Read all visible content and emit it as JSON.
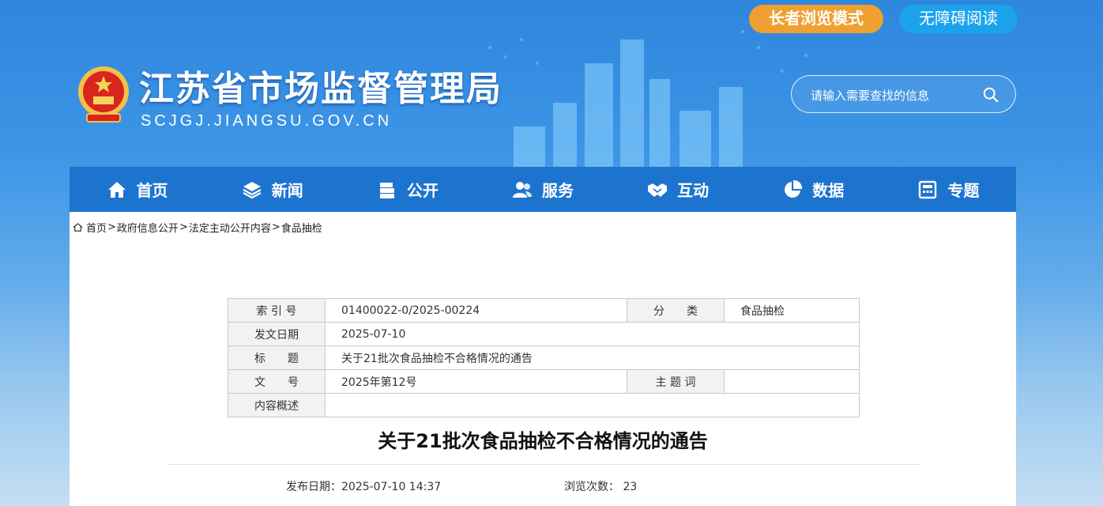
{
  "top_buttons": {
    "elder_mode": "长者浏览模式",
    "accessible": "无障碍阅读"
  },
  "header": {
    "title": "江苏省市场监督管理局",
    "url": "SCJGJ.JIANGSU.GOV.CN",
    "search_placeholder": "请输入需要查找的信息"
  },
  "nav": [
    {
      "label": "首页",
      "icon": "home-icon"
    },
    {
      "label": "新闻",
      "icon": "layers-icon"
    },
    {
      "label": "公开",
      "icon": "documents-icon"
    },
    {
      "label": "服务",
      "icon": "users-icon"
    },
    {
      "label": "互动",
      "icon": "handshake-icon"
    },
    {
      "label": "数据",
      "icon": "pie-chart-icon"
    },
    {
      "label": "专题",
      "icon": "calculator-icon"
    }
  ],
  "breadcrumb": [
    "首页",
    "政府信息公开",
    "法定主动公开内容",
    "食品抽检"
  ],
  "meta": {
    "index_label": "索 引 号",
    "index_value": "01400022-0/2025-00224",
    "category_label": "分　　类",
    "category_value": "食品抽检",
    "date_label": "发文日期",
    "date_value": "2025-07-10",
    "title_label": "标　　题",
    "title_value": "关于21批次食品抽检不合格情况的通告",
    "docno_label": "文　　号",
    "docno_value": "2025年第12号",
    "keywords_label": "主 题 词",
    "keywords_value": "",
    "summary_label": "内容概述",
    "summary_value": ""
  },
  "article": {
    "title": "关于21批次食品抽检不合格情况的通告",
    "publish": "发布日期：2025-07-10 14:37",
    "views": "浏览次数： 23"
  },
  "colors": {
    "nav": "#1c74cf",
    "elder_button": "#f0a030",
    "accessible_button": "#1aa3ec"
  }
}
